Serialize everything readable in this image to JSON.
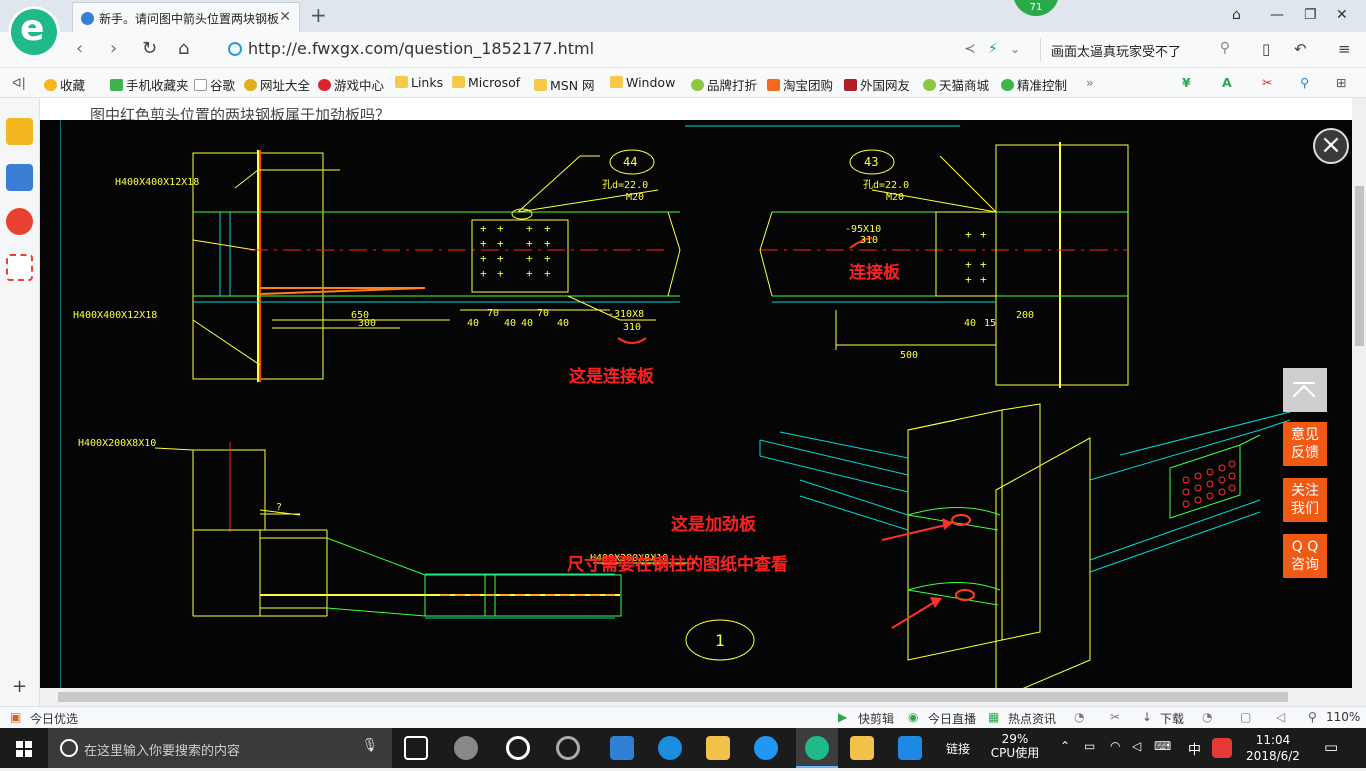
{
  "browser": {
    "tab_title": "新手。请问图中箭头位置两块钢板",
    "badge_count": "71",
    "url": "http://e.fwxgx.com/question_1852177.html",
    "search_text": "画面太逼真玩家受不了"
  },
  "bookmarks": [
    "收藏",
    "手机收藏夹",
    "谷歌",
    "网址大全",
    "游戏中心",
    "Links",
    "Microsof",
    "MSN 网",
    "Window",
    "品牌打折",
    "淘宝团购",
    "外国网友",
    "天猫商城",
    "精准控制"
  ],
  "page": {
    "background_text": "图中红色剪头位置的两块钢板属于加劲板吗？"
  },
  "cad": {
    "labels": {
      "h1": "H400X400X12X18",
      "h2": "H400X400X12X18",
      "h3": "H400X200X8X10",
      "h4": "H400X200X8X10",
      "mark44": "44",
      "mark43": "43",
      "hole1": "孔d=22.0",
      "bolt1": "M20",
      "hole2": "孔d=22.0",
      "bolt2": "M20",
      "plate1": "-310X8",
      "plate1w": "310",
      "plate2": "-95X10",
      "plate2w": "310",
      "dim650": "650",
      "dim300": "300",
      "dim500": "500",
      "dim200": "200",
      "dims_small": [
        "40",
        "70",
        "40",
        "40",
        "70",
        "40"
      ],
      "dims_small2": [
        "40",
        "15"
      ],
      "view_no": "1",
      "q_mark": "?"
    },
    "annotations": {
      "connect_plate_1": "这是连接板",
      "connect_plate_2": "连接板",
      "stiffener": "这是加劲板",
      "stiffener_note": "尺寸需要在钢柱的图纸中查看"
    }
  },
  "floating": {
    "feedback": [
      "意见",
      "反馈"
    ],
    "follow": [
      "关注",
      "我们"
    ],
    "qq": [
      "Q Q",
      "咨询"
    ]
  },
  "statusbar": {
    "left": "今日优选",
    "items": [
      "快剪辑",
      "今日直播",
      "热点资讯",
      "下载"
    ],
    "zoom": "110%"
  },
  "taskbar": {
    "search_placeholder": "在这里输入你要搜索的内容",
    "links": "链接",
    "cpu_percent": "29%",
    "cpu_label": "CPU使用",
    "ime": "中",
    "time": "11:04",
    "date": "2018/6/2"
  }
}
